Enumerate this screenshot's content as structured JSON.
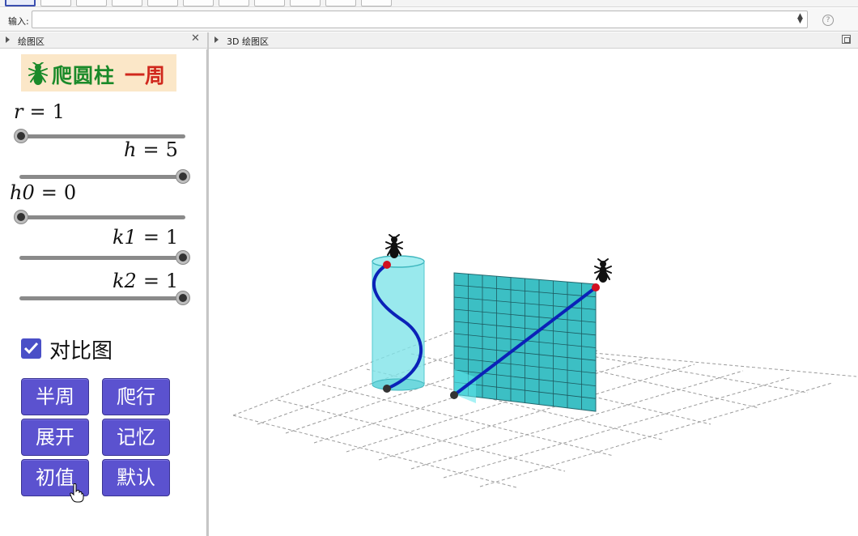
{
  "toolbar": {
    "tool_count": 11
  },
  "input_bar": {
    "label": "输入:",
    "value": "",
    "placeholder": ""
  },
  "left_view": {
    "title": "绘图区"
  },
  "right_view": {
    "title": "3D 绘图区"
  },
  "app_title": {
    "main": "爬圆柱",
    "accent": "一周"
  },
  "sliders": [
    {
      "name": "r",
      "value": "1",
      "fraction": 0.0
    },
    {
      "name": "h",
      "value": "5",
      "fraction": 1.0
    },
    {
      "name": "h0",
      "value": "0",
      "fraction": 0.0
    },
    {
      "name": "k1",
      "value": "1",
      "fraction": 1.0
    },
    {
      "name": "k2",
      "value": "1",
      "fraction": 1.0
    }
  ],
  "checkbox": {
    "label": "对比图",
    "checked": true
  },
  "buttons": {
    "half_turn": "半周",
    "crawl": "爬行",
    "unfold": "展开",
    "memory": "记忆",
    "initial": "初值",
    "default": "默认"
  },
  "colors": {
    "accent_purple": "#5b52cf",
    "title_bg": "#fbe7c8",
    "title_green": "#1b8a2a",
    "title_red": "#d0281d",
    "cylinder": "#7fe3e8",
    "path_blue": "#0b22b8",
    "point_red": "#d10f1f",
    "point_dark": "#333333"
  },
  "icons": [
    "ant-icon",
    "help-icon",
    "close-icon",
    "maximize-icon",
    "hand-cursor-icon"
  ]
}
